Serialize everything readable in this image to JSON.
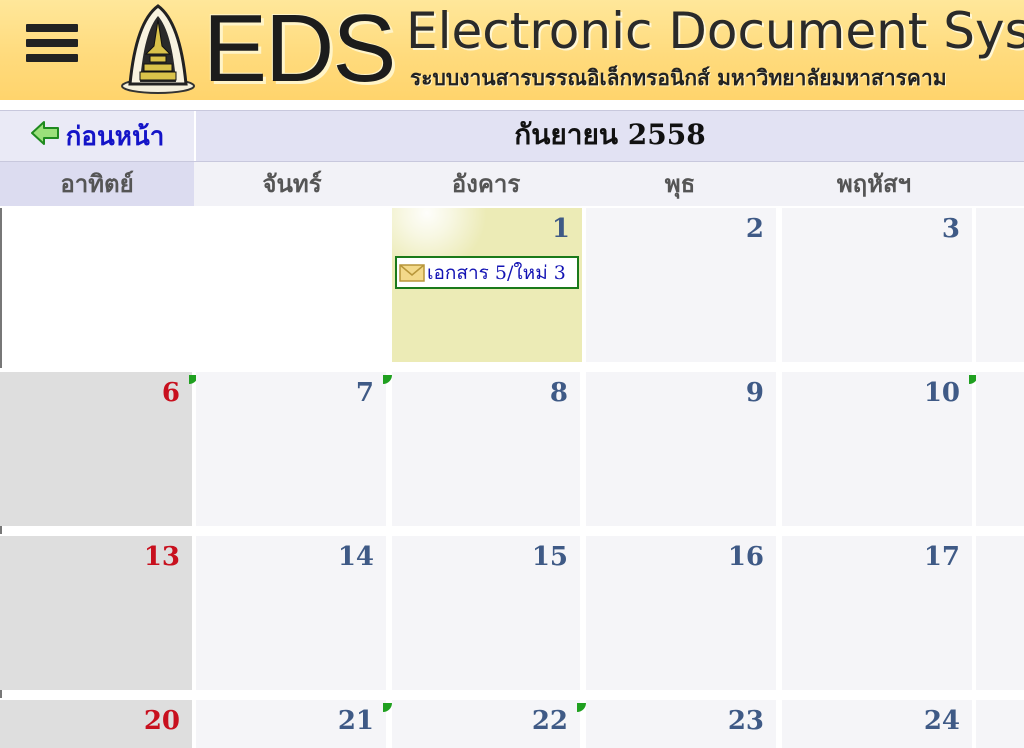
{
  "header": {
    "logo_text": "EDS",
    "title": "Electronic Document System",
    "subtitle": "ระบบงานสารบรรณอิเล็กทรอนิกส์ มหาวิทยาลัยมหาสารคาม",
    "menu_icon": "hamburger-menu-icon",
    "background": "#ffdb7d"
  },
  "calendar": {
    "prev_label": "ก่อนหน้า",
    "prev_icon": "arrow-left-icon",
    "month_title": "กันยายน 2558",
    "weekdays": [
      "อาทิตย์",
      "จันทร์",
      "อังคาร",
      "พุธ",
      "พฤหัสฯ"
    ],
    "colors": {
      "sunday_number": "#c8101e",
      "day_number": "#3f5a86",
      "event_text": "#1414b4",
      "event_border": "#1a7a1a",
      "today_bg": "#ecebb6"
    },
    "weeks": [
      {
        "days": [
          "",
          "",
          "1",
          "2",
          "3"
        ]
      },
      {
        "days": [
          "6",
          "7",
          "8",
          "9",
          "10"
        ]
      },
      {
        "days": [
          "13",
          "14",
          "15",
          "16",
          "17"
        ]
      },
      {
        "days": [
          "20",
          "21",
          "22",
          "23",
          "24"
        ]
      }
    ],
    "event": {
      "day": "1",
      "label": "เอกสาร 5/ใหม่ 3",
      "icon": "envelope-icon"
    }
  }
}
